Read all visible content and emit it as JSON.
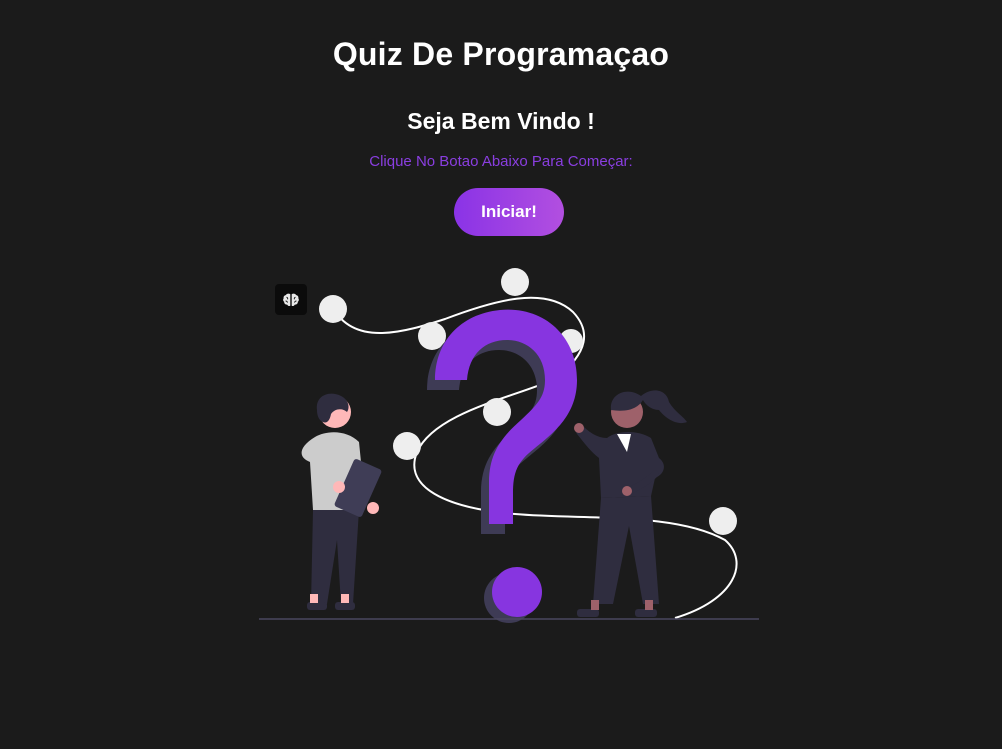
{
  "header": {
    "title": "Quiz De Programaçao",
    "welcome": "Seja Bem Vindo !",
    "instruction": "Clique No Botao Abaixo Para Começar:"
  },
  "actions": {
    "start_label": "Iniciar!"
  },
  "icons": {
    "badge": "brain-icon"
  },
  "colors": {
    "background": "#1b1b1b",
    "accent": "#8a33e6",
    "accent_end": "#b24fe0",
    "question_mark": "#8735e0",
    "figure_dark": "#2f2d3f"
  }
}
